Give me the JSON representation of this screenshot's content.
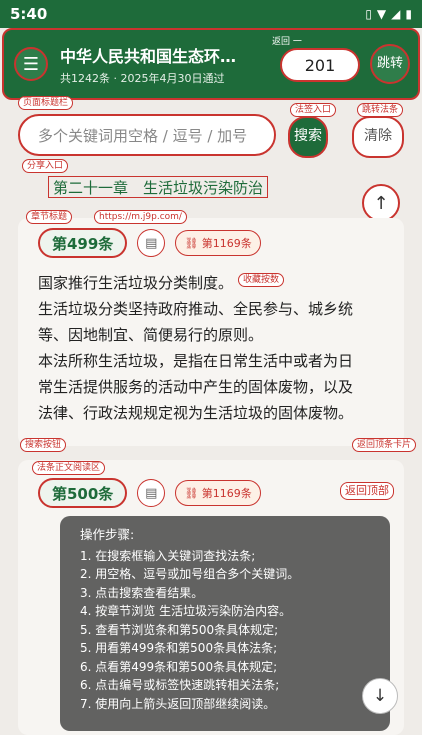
{
  "status": {
    "time": "5:40",
    "icons": [
      "vibrate-icon",
      "wifi-icon",
      "signal-icon",
      "battery-icon"
    ]
  },
  "header": {
    "menu_icon": "☰",
    "title": "中华人民共和国生态环…",
    "subtitle": "共1242条 · 2025年4月30日通过",
    "back_label": "返回 一",
    "jump_value": "201",
    "jump_button": "跳转"
  },
  "annotations": {
    "page_title_bar": "页面标题栏",
    "law_tag_entry": "法签入口",
    "jump_law": "跳转法条",
    "share_entry": "分享入口",
    "chapter_title": "章节标题",
    "url": "https://m.j9p.com/",
    "favorite_count": "收藏按数",
    "search_button": "搜索按钮",
    "back_to_top_card": "返回顶条卡片",
    "article_reading_area": "法条正文阅读区",
    "back_to_top": "返回顶部"
  },
  "search": {
    "placeholder": "多个关键词用空格 / 逗号 / 加号",
    "search_label": "搜索",
    "clear_label": "清除"
  },
  "chapter": {
    "title": "第二十一章　生活垃圾污染防治"
  },
  "articles": [
    {
      "number": "第499条",
      "ref": "第1169条",
      "lines": [
        "国家推行生活垃圾分类制度。",
        "生活垃圾分类坚持政府推动、全民参与、城乡统",
        "等、因地制宜、简便易行的原则。",
        "本法所称生活垃圾，是指在日常生活中或者为日",
        "常生活提供服务的活动中产生的固体废物，以及",
        "法律、行政法规规定视为生活垃圾的固体废物。"
      ]
    },
    {
      "number": "第500条",
      "ref": "第1169条"
    }
  ],
  "steps": {
    "title": "操作步骤:",
    "items": [
      "1. 在搜索框输入关键词查找法条;",
      "2. 用空格、逗号或加号组合多个关键词。",
      "3. 点击搜索查看结果。",
      "4. 按章节浏览 生活垃圾污染防治内容。",
      "5. 查看节浏览条和第500条具体规定;",
      "5. 用看第499条和第500条具体法条;",
      "6. 点看第499条和第500条具体规定;",
      "6. 点击编号或标签快速跳转相关法条;",
      "7. 使用向上箭头返回顶部继续阅读。"
    ]
  },
  "nav": {
    "up_icon": "↑",
    "down_icon": "↓"
  },
  "colors": {
    "primary": "#1e6b3a",
    "annotation": "#c9342f",
    "background": "#efece8"
  }
}
